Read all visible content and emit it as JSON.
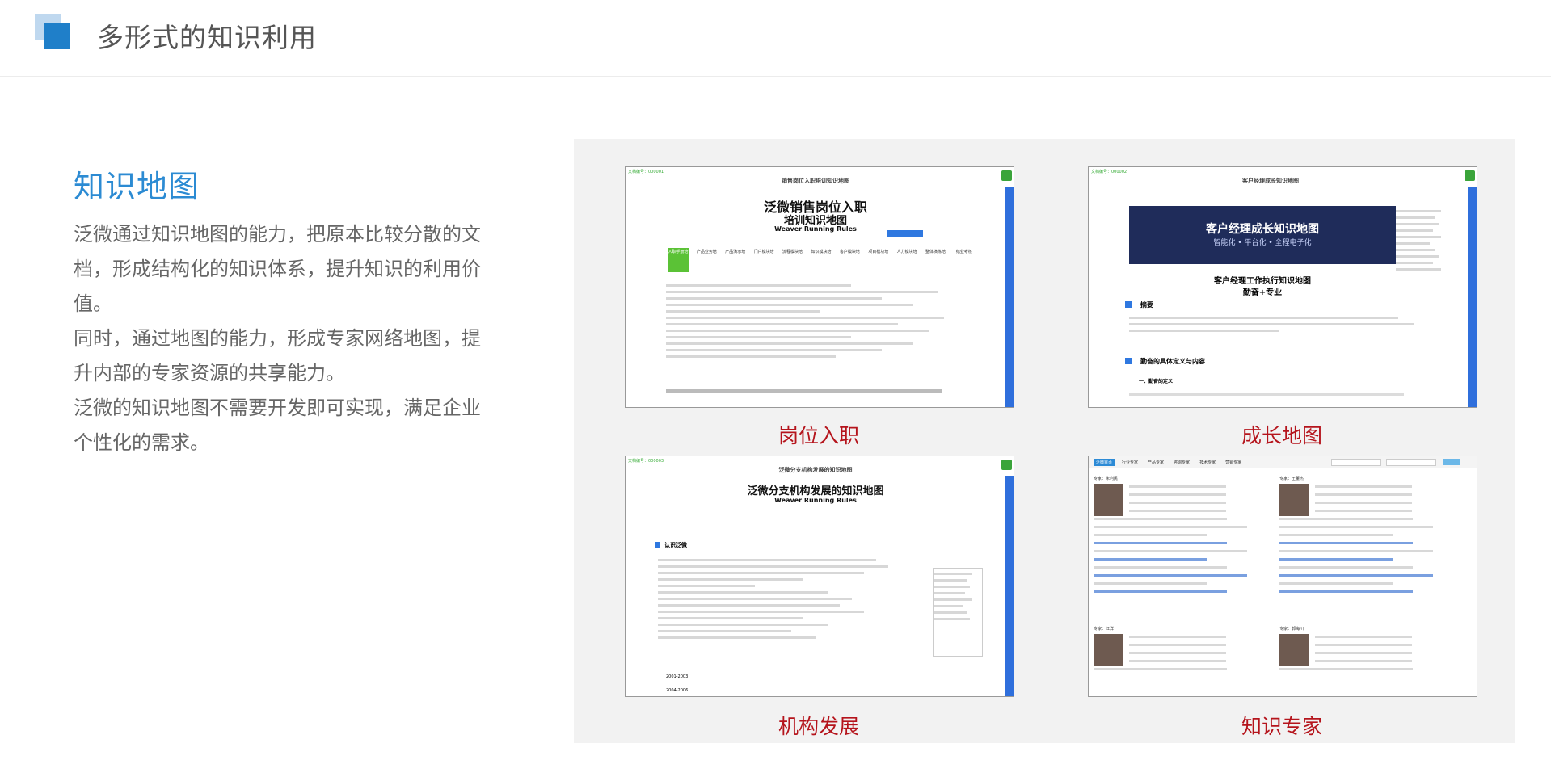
{
  "header": {
    "title": "多形式的知识利用"
  },
  "left": {
    "title": "知识地图",
    "paragraphs": [
      "泛微通过知识地图的能力，把原本比较分散的文档，形成结构化的知识体系，提升知识的利用价值。",
      "同时，通过地图的能力，形成专家网络地图，提升内部的专家资源的共享能力。",
      "泛微的知识地图不需要开发即可实现，满足企业个性化的需求。"
    ]
  },
  "cards": [
    {
      "caption": "岗位入职",
      "doc_header": "销售岗位入职培训知识地图",
      "title_line1": "泛微销售岗位入职",
      "title_line2": "培训知识地图",
      "subtitle": "Weaver Running Rules",
      "steps": [
        "入职手册培",
        "产品业务培",
        "产品演示培",
        "门户模块培",
        "流程模块培",
        "知识模块培",
        "客户模块培",
        "项目模块培",
        "人力模块培",
        "整体演练培",
        "结业考核"
      ]
    },
    {
      "caption": "成长地图",
      "doc_header": "客户经理成长知识地图",
      "banner_title": "客户经理成长知识地图",
      "banner_sub": "智能化 • 平台化 • 全程电子化",
      "title_line1": "客户经理工作执行知识地图",
      "title_line2": "勤奋+专业",
      "sec1": "摘要",
      "sec2": "勤奋的具体定义与内容",
      "sec3": "一、勤奋的定义"
    },
    {
      "caption": "机构发展",
      "doc_header": "泛微分支机构发展的知识地图",
      "title_line1": "泛微分支机构发展的知识地图",
      "subtitle": "Weaver Running Rules",
      "sec1": "认识泛微",
      "years": [
        "2001-2003",
        "2004-2006"
      ]
    },
    {
      "caption": "知识专家",
      "tabs": [
        "泛微首页",
        "行业专家",
        "产品专家",
        "咨询专家",
        "技术专家",
        "营销专家"
      ],
      "experts": [
        "专家：朱利民",
        "专家：王董杰",
        "专家：江洋",
        "专家：郭海川"
      ]
    }
  ]
}
